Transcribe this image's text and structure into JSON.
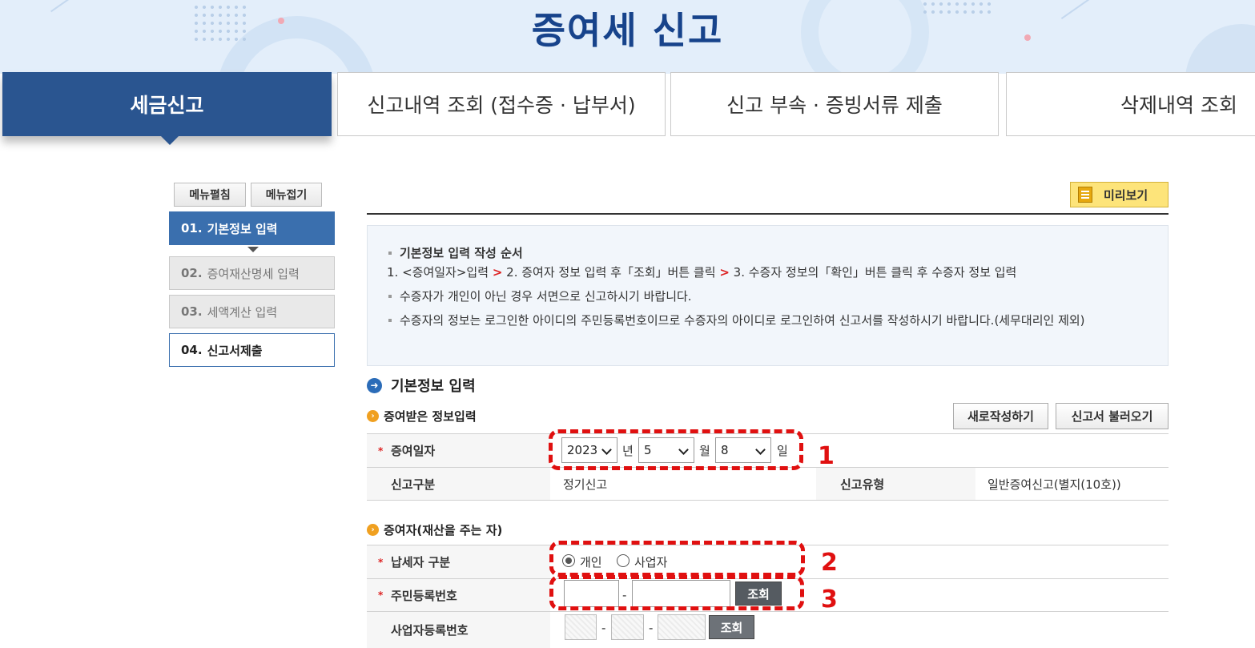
{
  "header": {
    "title": "증여세 신고"
  },
  "tabs": [
    {
      "label": "세금신고"
    },
    {
      "label": "신고내역 조회 (접수증 · 납부서)"
    },
    {
      "label": "신고 부속 · 증빙서류 제출"
    },
    {
      "label": "삭제내역 조회"
    }
  ],
  "sidebar": {
    "expand_label": "메뉴펼침",
    "collapse_label": "메뉴접기",
    "steps": [
      {
        "num": "01.",
        "label": "기본정보 입력"
      },
      {
        "num": "02.",
        "label": "증여재산명세 입력"
      },
      {
        "num": "03.",
        "label": "세액계산 입력"
      },
      {
        "num": "04.",
        "label": "신고서제출"
      }
    ]
  },
  "preview": {
    "label": "미리보기",
    "icon": "document-icon"
  },
  "guide": {
    "title": "기본정보 입력 작성 순서",
    "step1": "1. <증여일자>입력",
    "step2": "2. 증여자 정보 입력 후「조회」버튼 클릭",
    "step3": "3. 수증자 정보의「확인」버튼 클릭 후 수증자 정보 입력",
    "arrow": ">",
    "note1": "수증자가 개인이 아닌 경우 서면으로 신고하시기 바랍니다.",
    "note2": "수증자의 정보는 로그인한 아이디의 주민등록번호이므로 수증자의 아이디로 로그인하여 신고서를 작성하시기 바랍니다.(세무대리인 제외)"
  },
  "section": {
    "title": "기본정보 입력",
    "new_label": "새로작성하기",
    "load_label": "신고서 불러오기"
  },
  "gift_info": {
    "title": "증여받은 정보입력",
    "date_label": "증여일자",
    "year": "2023",
    "year_unit": "년",
    "month": "5",
    "month_unit": "월",
    "day": "8",
    "day_unit": "일",
    "report_type_label": "신고구분",
    "report_type_value": "정기신고",
    "report_kind_label": "신고유형",
    "report_kind_value": "일반증여신고(별지(10호))"
  },
  "donor": {
    "title": "증여자(재산을 주는 자)",
    "taxpayer_label": "납세자 구분",
    "option_individual": "개인",
    "option_business": "사업자",
    "selected": "개인",
    "rrn_label": "주민등록번호",
    "rrn_button": "조회",
    "brn_label": "사업자등록번호",
    "brn_button": "조회",
    "dash": "-"
  },
  "required_mark": "*",
  "annotations": [
    "1",
    "2",
    "3"
  ],
  "colors": {
    "brand": "#17438b",
    "active_tab": "#2a5590",
    "annotation": "#e01010",
    "preview": "#fde47a"
  }
}
